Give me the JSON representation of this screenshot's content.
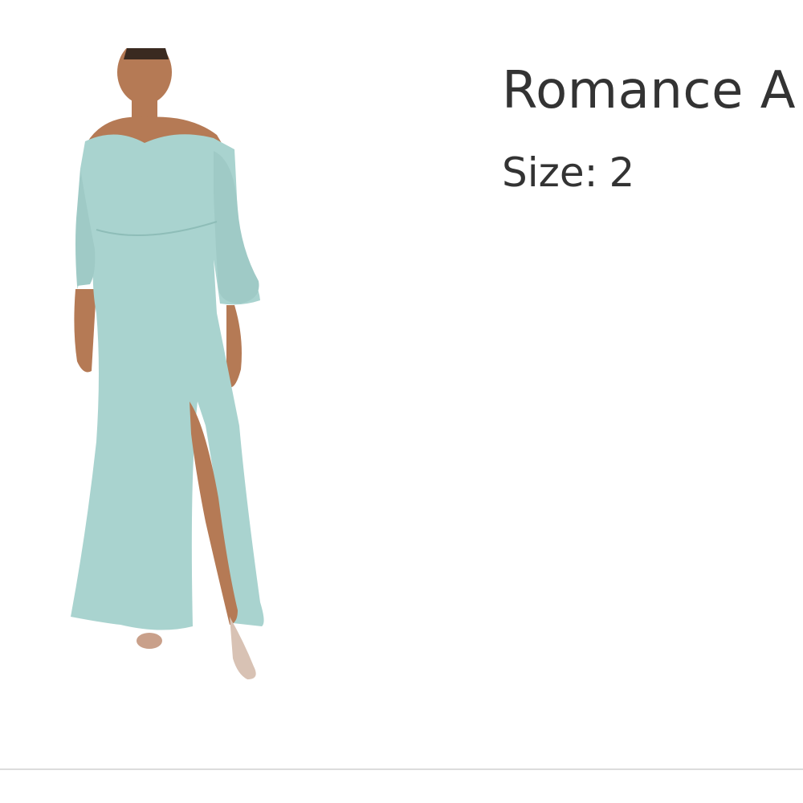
{
  "product": {
    "name": "Romance A",
    "size_label": "Size:",
    "size_value": "2"
  },
  "image": {
    "icon": "dress-model-photo",
    "dress_color": "#a9d3cf",
    "skin_color": "#b57a55"
  }
}
